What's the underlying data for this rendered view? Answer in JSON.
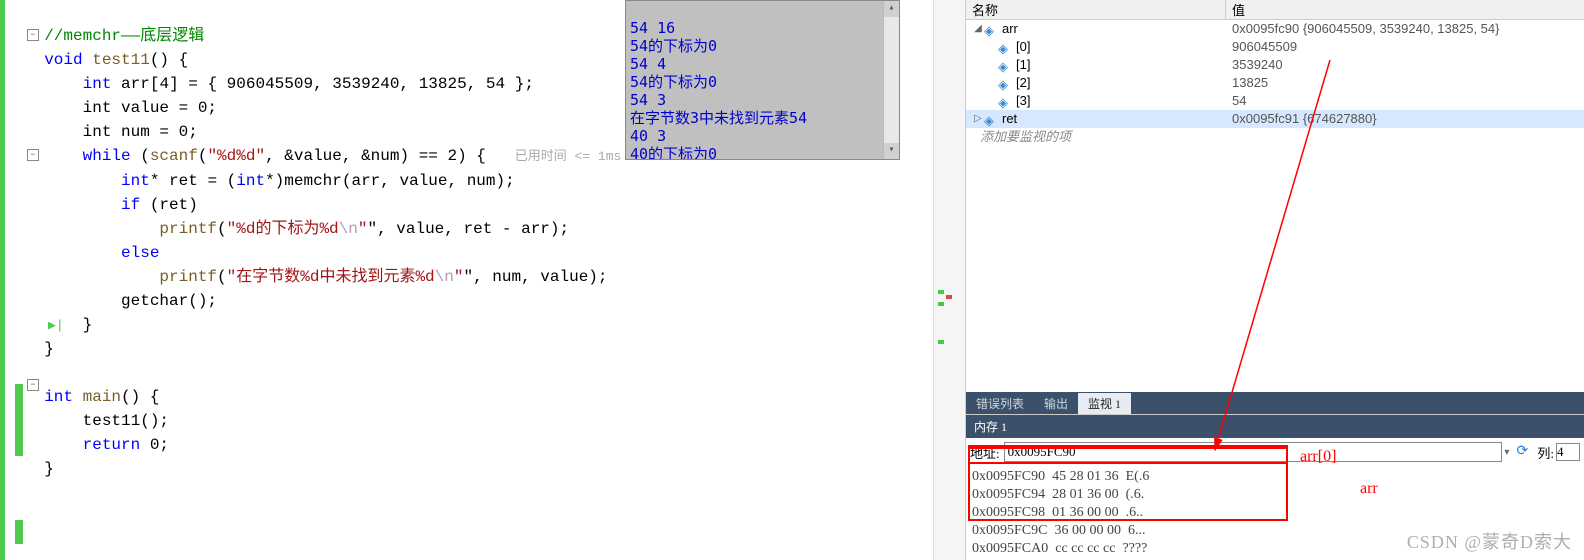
{
  "code": {
    "comment": "//memchr——底层逻辑",
    "fn_decl_keyword": "void",
    "fn_name": "test11",
    "arr_decl_type": "int",
    "arr_decl_name": "arr",
    "arr_size": "4",
    "arr_init": "{ 906045509, 3539240, 13825, 54 }",
    "value_decl": "int value = 0;",
    "num_decl": "int num = 0;",
    "while_kw": "while",
    "scanf_name": "scanf",
    "scanf_fmt": "\"%d%d\"",
    "scanf_args": ", &value, &num) == 2) {",
    "hint": "已用时间 <= 1ms",
    "ret_decl_a": "int",
    "ret_decl_b": "* ret = (",
    "ret_decl_c": "int",
    "ret_decl_d": "*)memchr(arr, value, num);",
    "if_kw": "if",
    "if_cond": " (ret)",
    "printf1": "printf",
    "printf1_str": "\"%d的下标为%d",
    "printf1_esc": "\\n",
    "printf1_rest": "\", value, ret - arr);",
    "else_kw": "else",
    "printf2": "printf",
    "printf2_str": "\"在字节数%d中未找到元素%d",
    "printf2_esc": "\\n",
    "printf2_rest": "\", num, value);",
    "getchar": "getchar();",
    "main_kw": "int",
    "main_name": "main",
    "test_call": "test11();",
    "return_kw": "return",
    "return_val": " 0;"
  },
  "console": {
    "lines": [
      "54 16",
      "54的下标为0",
      "54 4",
      "54的下标为0",
      "54 3",
      "在字节数3中未找到元素54",
      "40 3",
      "40的下标为0"
    ]
  },
  "watch": {
    "header_name": "名称",
    "header_value": "值",
    "rows": [
      {
        "indent": 0,
        "expand": "▢",
        "icon": true,
        "name": "arr",
        "value": "0x0095fc90 {906045509, 3539240, 13825, 54}"
      },
      {
        "indent": 1,
        "expand": "",
        "icon": true,
        "name": "[0]",
        "value": "906045509"
      },
      {
        "indent": 1,
        "expand": "",
        "icon": true,
        "name": "[1]",
        "value": "3539240"
      },
      {
        "indent": 1,
        "expand": "",
        "icon": true,
        "name": "[2]",
        "value": "13825"
      },
      {
        "indent": 1,
        "expand": "",
        "icon": true,
        "name": "[3]",
        "value": "54"
      },
      {
        "indent": 0,
        "expand": "▷",
        "icon": true,
        "name": "ret",
        "value": "0x0095fc91 {674627880}"
      }
    ],
    "add_hint": "添加要监视的项"
  },
  "tabs": {
    "t1": "错误列表",
    "t2": "输出",
    "t3": "监视 1"
  },
  "memory": {
    "title": "内存 1",
    "addr_label": "地址:",
    "addr_value": "0x0095FC90",
    "col_label": "列:",
    "col_value": "4",
    "lines": [
      {
        "addr": "0x0095FC90",
        "hex": "45 28 01 36",
        "ascii": "E(.6"
      },
      {
        "addr": "0x0095FC94",
        "hex": "28 01 36 00",
        "ascii": "(.6."
      },
      {
        "addr": "0x0095FC98",
        "hex": "01 36 00 00",
        "ascii": ".6.."
      },
      {
        "addr": "0x0095FC9C",
        "hex": "36 00 00 00",
        "ascii": "6..."
      },
      {
        "addr": "0x0095FCA0",
        "hex": "cc cc cc cc",
        "ascii": "????"
      }
    ]
  },
  "annotations": {
    "arr0": "arr[0]",
    "arr": "arr"
  },
  "watermark": "CSDN @蒙奇D索大"
}
